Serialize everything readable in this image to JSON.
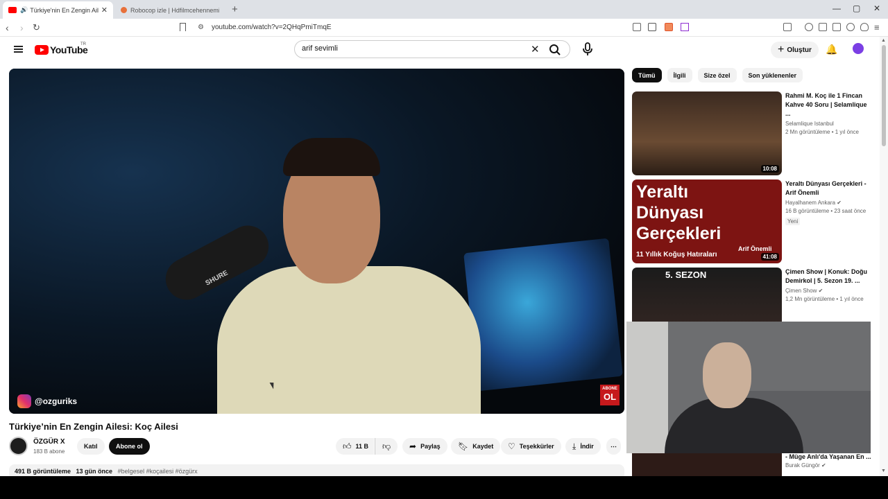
{
  "browser": {
    "tabs": [
      {
        "title": "Türkiye'nin En Zengin Ailesi: K",
        "active": true,
        "audio": true
      },
      {
        "title": "Robocop izle | Hdfilmcehennemi | Fil",
        "active": false
      }
    ],
    "new_tab": "+",
    "url": "youtube.com/watch?v=2QHqPmiTmqE",
    "window_controls": {
      "minimize": "—",
      "maximize": "▢",
      "close": "✕"
    }
  },
  "header": {
    "logo_text": "YouTube",
    "country": "TR",
    "search_value": "arif sevimli",
    "create_label": "Oluştur"
  },
  "video": {
    "overlay_handle": "@ozguriks",
    "badge_top": "ABONE",
    "badge_bottom": "OL",
    "mic_brand": "SHURE",
    "title": "Türkiye’nin En Zengin Ailesi: Koç Ailesi",
    "channel": "ÖZGÜR X",
    "subscribers": "183 B abone",
    "join_label": "Katıl",
    "subscribe_label": "Abone ol",
    "likes": "11 B",
    "share_label": "Paylaş",
    "save_label": "Kaydet",
    "thanks_label": "Teşekkürler",
    "download_label": "İndir",
    "more": "⋯",
    "views": "491 B görüntüleme",
    "age": "13 gün önce",
    "tags": "#belgesel #koçailesi #özgürx"
  },
  "chips": [
    "Tümü",
    "İlgili",
    "Size özel",
    "Son yüklenenler"
  ],
  "recommendations": [
    {
      "title": "Rahmi M. Koç ile 1 Fincan Kahve 40 Soru | Selamlique ...",
      "channel": "Selamlique Istanbul",
      "stats": "2 Mn görüntüleme • 1 yıl önce",
      "duration": "10:08"
    },
    {
      "title": "Yeraltı Dünyası Gerçekleri - Arif Önemli",
      "channel": "Hayalhanem Ankara",
      "stats": "16 B görüntüleme • 23 saat önce",
      "badge": "Yeni",
      "duration": "41:08",
      "thumb_big": "Yeraltı Dünyası Gerçekleri",
      "thumb_sub": "11 Yıllık Koğuş Hatıraları",
      "thumb_name": "Arif Önemli"
    },
    {
      "title": "Çimen Show | Konuk: Doğu Demirkol | 5. Sezon 19. ...",
      "channel": "Çimen Show",
      "stats": "1,2 Mn görüntüleme • 1 yıl önce",
      "thumb_top": "5. SEZON"
    },
    {
      "title": "- Müge Anlı'da Yaşanan En ...",
      "channel": "Burak Güngör"
    }
  ]
}
